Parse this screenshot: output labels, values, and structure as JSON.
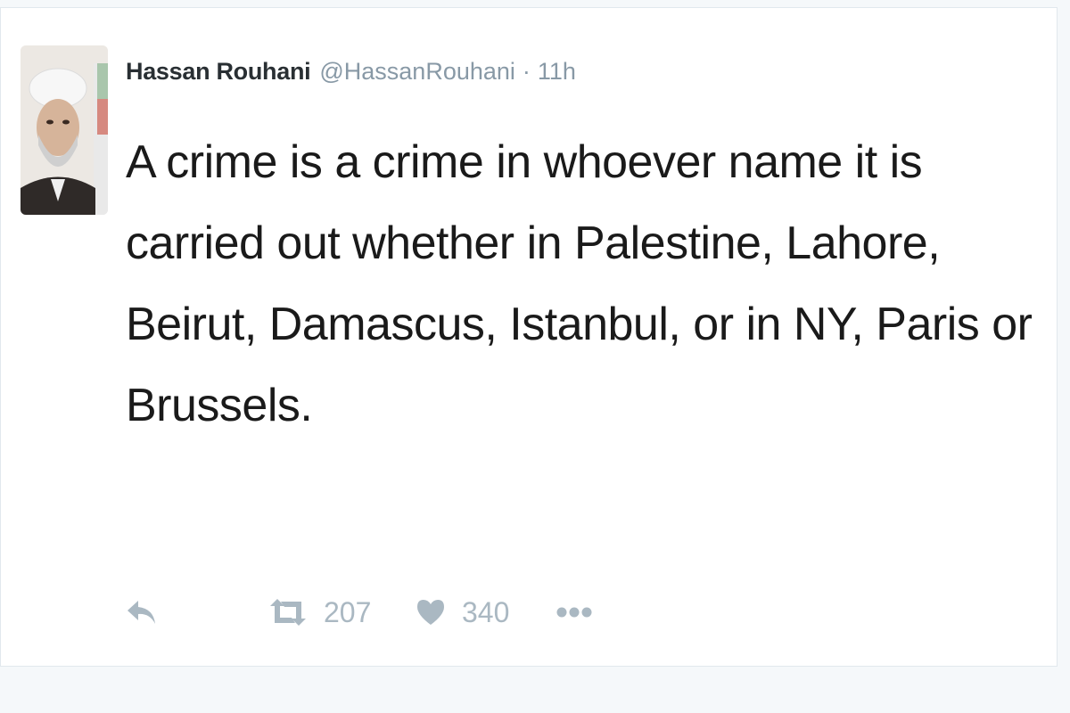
{
  "tweet": {
    "author": {
      "display_name": "Hassan Rouhani",
      "username": "@HassanRouhani",
      "avatar_icon": "user-avatar"
    },
    "separator": "·",
    "timestamp": "11h",
    "text": "A crime is a crime in whoever name it is carried out whether in Palestine, Lahore, Beirut, Damascus, Istanbul, or in NY, Paris or Brussels.",
    "actions": {
      "reply_icon": "reply-icon",
      "retweet_icon": "retweet-icon",
      "retweet_count": "207",
      "like_icon": "heart-icon",
      "like_count": "340",
      "more_icon": "more-dots-icon"
    }
  },
  "colors": {
    "text": "#1a1a1a",
    "secondary": "#8899a6",
    "action": "#aab8c2",
    "background": "#f5f8fa",
    "card": "#ffffff"
  }
}
